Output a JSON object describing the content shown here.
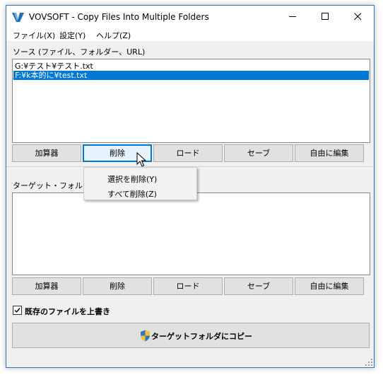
{
  "window": {
    "title": "VOVSOFT - Copy Files Into Multiple Folders"
  },
  "title_buttons": {
    "minimize": "minimize-icon",
    "maximize": "maximize-icon",
    "close": "close-icon"
  },
  "menu": [
    "ファイル(X)",
    "設定(Y)",
    "ヘルプ(Z)"
  ],
  "source": {
    "label": "ソース (ファイル、フォルダー、URL)",
    "items": [
      {
        "text": "G:¥テスト¥テスト.txt",
        "selected": false
      },
      {
        "text": "F:¥k本的に¥test.txt",
        "selected": true
      }
    ],
    "buttons": [
      "加算器",
      "削除",
      "ロード",
      "セーブ",
      "自由に編集"
    ]
  },
  "context_menu": {
    "items": [
      "選択を削除(Y)",
      "すべて削除(Z)"
    ]
  },
  "target": {
    "label": "ターゲット・フォルダー",
    "items": [],
    "buttons": [
      "加算器",
      "削除",
      "ロード",
      "セーブ",
      "自由に編集"
    ]
  },
  "options": {
    "overwrite_label": "既存のファイルを上書き",
    "overwrite_checked": true
  },
  "action": {
    "copy_label": "ターゲットフォルダにコピー",
    "icon": "uac-shield-icon"
  },
  "colors": {
    "selection": "#0078d7",
    "window_border": "#2b78c5",
    "button_face": "#e1e1e1",
    "hot_border": "#0078d7"
  }
}
